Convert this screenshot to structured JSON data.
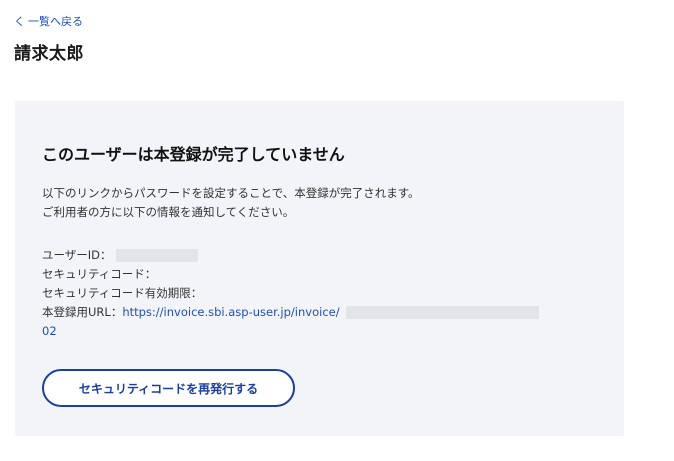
{
  "nav": {
    "back_chevron": "く",
    "back_label": "一覧へ戻る"
  },
  "page": {
    "title": "請求太郎"
  },
  "notice": {
    "heading": "このユーザーは本登録が完了していません",
    "desc_line1": "以下のリンクからパスワードを設定することで、本登録が完了されます。",
    "desc_line2": "ご利用者の方に以下の情報を通知してください。"
  },
  "info": {
    "user_id_label": "ユーザーID：",
    "security_code_label": "セキュリティコード：",
    "expiry_label": "セキュリティコード有効期限：",
    "url_label": "本登録用URL：",
    "url_text": "https://invoice.sbi.asp-user.jp/invoice/",
    "url_suffix": "02"
  },
  "actions": {
    "reissue_label": "セキュリティコードを再発行する"
  },
  "colors": {
    "link": "#1f4fbf",
    "button_border": "#1a3f9f",
    "panel_bg": "#f2f4f8"
  }
}
